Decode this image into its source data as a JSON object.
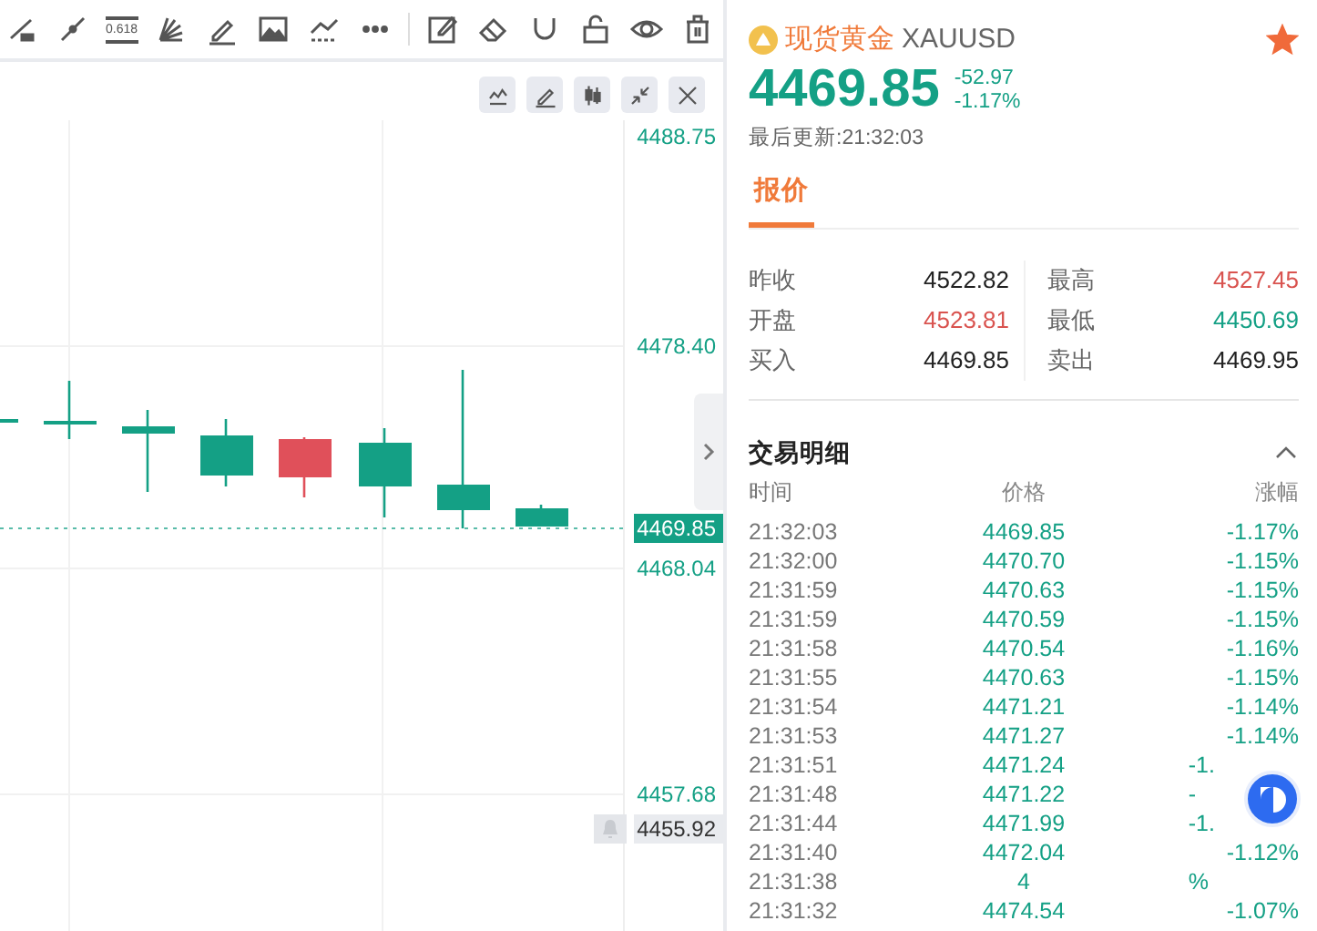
{
  "toolbar": {
    "items": [
      {
        "kind": "icon"
      },
      {
        "kind": "icon"
      },
      {
        "kind": "fib",
        "label": "0.618"
      },
      {
        "kind": "icon"
      },
      {
        "kind": "icon"
      },
      {
        "kind": "icon"
      },
      {
        "kind": "icon"
      },
      {
        "kind": "icon"
      },
      {
        "kind": "sep"
      },
      {
        "kind": "icon"
      },
      {
        "kind": "icon"
      },
      {
        "kind": "icon"
      },
      {
        "kind": "icon"
      },
      {
        "kind": "icon"
      },
      {
        "kind": "icon"
      }
    ]
  },
  "chart_controls": [
    {
      "kind": "button"
    },
    {
      "kind": "button"
    },
    {
      "kind": "button"
    },
    {
      "kind": "button"
    },
    {
      "kind": "button"
    }
  ],
  "price_axis": [
    {
      "label": "4488.75",
      "kind": "tick"
    },
    {
      "label": "4478.40",
      "kind": "tick"
    },
    {
      "label": "4469.85",
      "kind": "current"
    },
    {
      "label": "4468.04",
      "kind": "tick"
    },
    {
      "label": "4457.68",
      "kind": "tick"
    },
    {
      "label": "4455.92",
      "kind": "alert"
    }
  ],
  "instrument": {
    "name": "现货黄金",
    "symbol": "XAUUSD",
    "favorite": true,
    "price": "4469.85",
    "change": "-52.97",
    "change_pct": "-1.17%",
    "updated": "最后更新:21:32:03"
  },
  "tabs": [
    {
      "label": "报价",
      "selected": true
    }
  ],
  "quote": [
    {
      "label": "昨收",
      "value": "4522.82",
      "color": "#222222"
    },
    {
      "label": "最高",
      "value": "4527.45",
      "color": "#d9534f"
    },
    {
      "label": "开盘",
      "value": "4523.81",
      "color": "#d9534f"
    },
    {
      "label": "最低",
      "value": "4450.69",
      "color": "#14a085"
    },
    {
      "label": "买入",
      "value": "4469.85",
      "color": "#222222"
    },
    {
      "label": "卖出",
      "value": "4469.95",
      "color": "#222222"
    }
  ],
  "trades": {
    "title": "交易明细",
    "expanded": true,
    "columns": [
      "时间",
      "价格",
      "涨幅"
    ],
    "rows": [
      {
        "time": "21:32:03",
        "price": "4469.85",
        "change": "-1.17%"
      },
      {
        "time": "21:32:00",
        "price": "4470.70",
        "change": "-1.15%"
      },
      {
        "time": "21:31:59",
        "price": "4470.63",
        "change": "-1.15%"
      },
      {
        "time": "21:31:59",
        "price": "4470.59",
        "change": "-1.15%"
      },
      {
        "time": "21:31:58",
        "price": "4470.54",
        "change": "-1.16%"
      },
      {
        "time": "21:31:55",
        "price": "4470.63",
        "change": "-1.15%"
      },
      {
        "time": "21:31:54",
        "price": "4471.21",
        "change": "-1.14%"
      },
      {
        "time": "21:31:53",
        "price": "4471.27",
        "change": "-1.14%"
      },
      {
        "time": "21:31:51",
        "price": "4471.24",
        "change": "-1."
      },
      {
        "time": "21:31:48",
        "price": "4471.22",
        "change": "-"
      },
      {
        "time": "21:31:44",
        "price": "4471.99",
        "change": "-1."
      },
      {
        "time": "21:31:40",
        "price": "4472.04",
        "change": "-1.12%"
      },
      {
        "time": "21:31:38",
        "price": "4",
        "change": "%"
      },
      {
        "time": "21:31:32",
        "price": "4474.54",
        "change": "-1.07%"
      }
    ]
  }
}
